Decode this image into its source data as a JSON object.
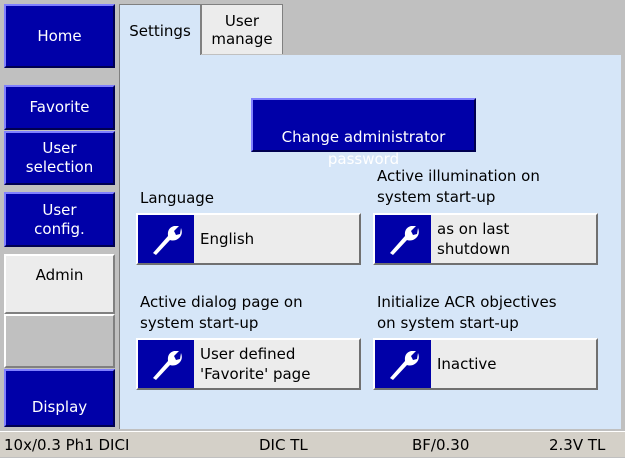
{
  "sidebar": {
    "items": [
      {
        "label": "Home"
      },
      {
        "label": "Favorite"
      },
      {
        "label": "User\nselection"
      },
      {
        "label": "User\nconfig."
      },
      {
        "label": "Admin"
      },
      {
        "label": "Display"
      }
    ]
  },
  "tabs": [
    {
      "label": "Settings"
    },
    {
      "label": "User\nmanage"
    }
  ],
  "admin": {
    "change_password_label": "Change administrator\npassword",
    "language": {
      "label": "Language",
      "value": "English"
    },
    "illumination": {
      "label": "Active illumination on\nsystem start-up",
      "value": "as on last\nshutdown"
    },
    "dialog_page": {
      "label": "Active dialog page on\nsystem start-up",
      "value": "User defined\n'Favorite' page"
    },
    "acr": {
      "label": "Initialize ACR objectives\non system start-up",
      "value": "Inactive"
    }
  },
  "status": {
    "objective": "10x/0.3 Ph1 DICI",
    "contrast": "DIC TL",
    "aperture": "BF/0.30",
    "voltage": "2.3V TL"
  },
  "colors": {
    "button_blue": "#0000a8",
    "panel_bg": "#d6e6f8",
    "setting_bg": "#ececec"
  },
  "icons": {
    "setting_icon": "wrench-icon"
  }
}
